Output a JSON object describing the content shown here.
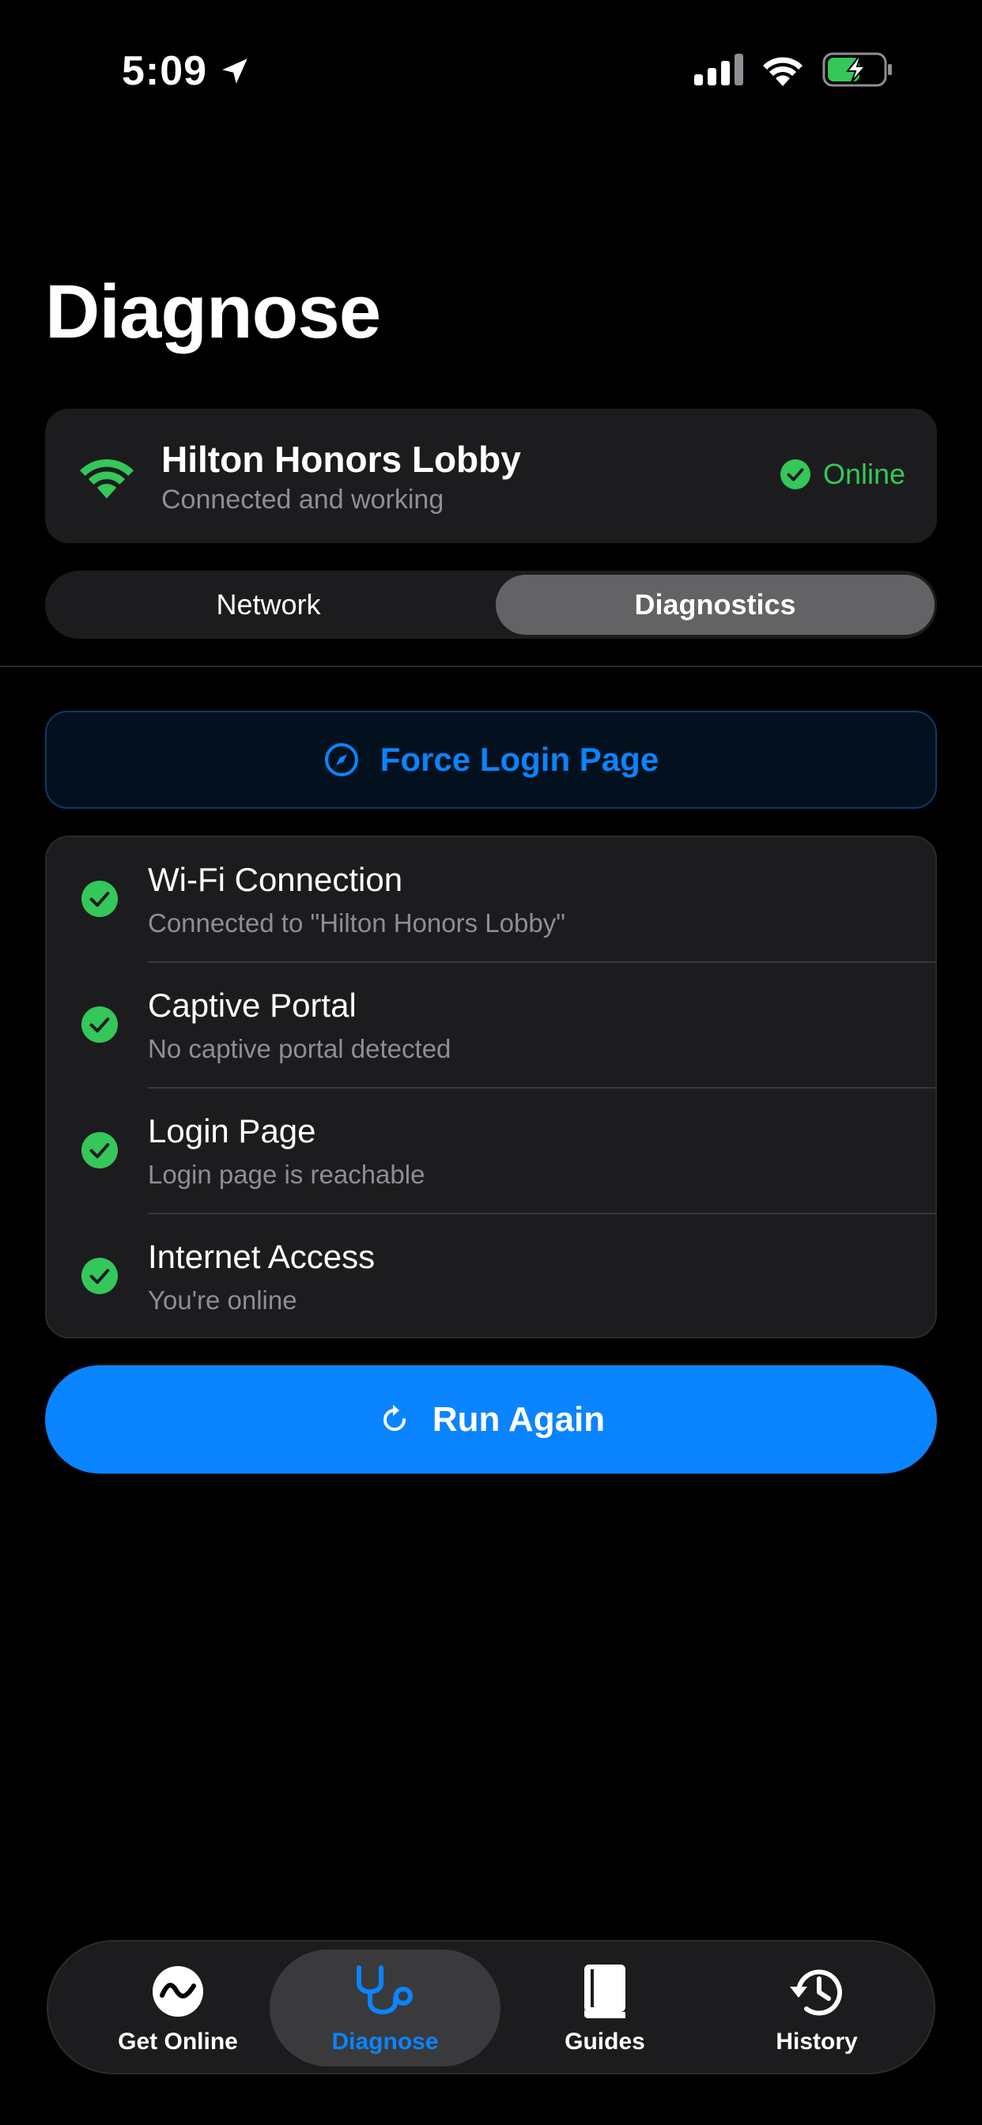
{
  "status_bar": {
    "time": "5:09"
  },
  "page": {
    "title": "Diagnose"
  },
  "network": {
    "name": "Hilton Honors Lobby",
    "subtitle": "Connected and working",
    "status": "Online"
  },
  "segments": {
    "network_label": "Network",
    "diagnostics_label": "Diagnostics",
    "selected": "Diagnostics"
  },
  "actions": {
    "force_login_label": "Force Login Page",
    "run_again_label": "Run Again"
  },
  "checks": [
    {
      "title": "Wi-Fi Connection",
      "subtitle": "Connected to \"Hilton Honors Lobby\"",
      "icon": "checkmark-circle-icon"
    },
    {
      "title": "Captive Portal",
      "subtitle": "No captive portal detected",
      "icon": "checkmark-circle-icon"
    },
    {
      "title": "Login Page",
      "subtitle": "Login page is reachable",
      "icon": "checkmark-circle-icon"
    },
    {
      "title": "Internet Access",
      "subtitle": "You're online",
      "icon": "checkmark-circle-icon"
    }
  ],
  "tabs": [
    {
      "label": "Get Online",
      "icon": "wave-circle-icon"
    },
    {
      "label": "Diagnose",
      "icon": "stethoscope-icon",
      "selected": true
    },
    {
      "label": "Guides",
      "icon": "book-icon"
    },
    {
      "label": "History",
      "icon": "clock-history-icon"
    }
  ],
  "colors": {
    "accent": "#0a84ff",
    "success": "#34c759",
    "card": "#1c1c1e",
    "background": "#000000"
  }
}
